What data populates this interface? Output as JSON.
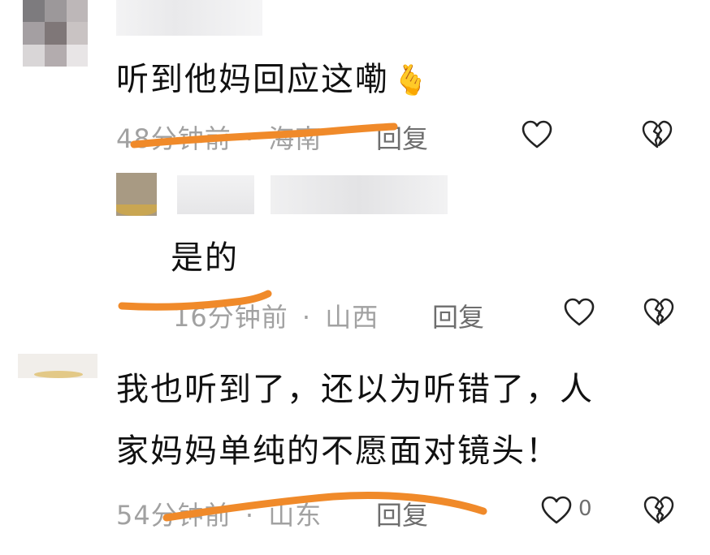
{
  "comments": [
    {
      "text": "听到他妈回应这嘞",
      "emoji": "🫰",
      "time": "48分钟前",
      "location": "海南",
      "reply_label": "回复"
    },
    {
      "text": "是的",
      "time": "16分钟前",
      "location": "山西",
      "reply_label": "回复"
    },
    {
      "text_line1": "我也听到了，还以为听错了，人",
      "text_line2": "家妈妈单纯的不愿面对镜头！",
      "time": "54分钟前",
      "location": "山东",
      "reply_label": "回复",
      "like_count": "0"
    }
  ],
  "separator": "·",
  "colors": {
    "scribble": "#f08a2a",
    "meta_text": "#a1a1a1",
    "reply_text": "#6e6e6e"
  },
  "icons": [
    "heart-outline-icon",
    "broken-heart-icon"
  ]
}
